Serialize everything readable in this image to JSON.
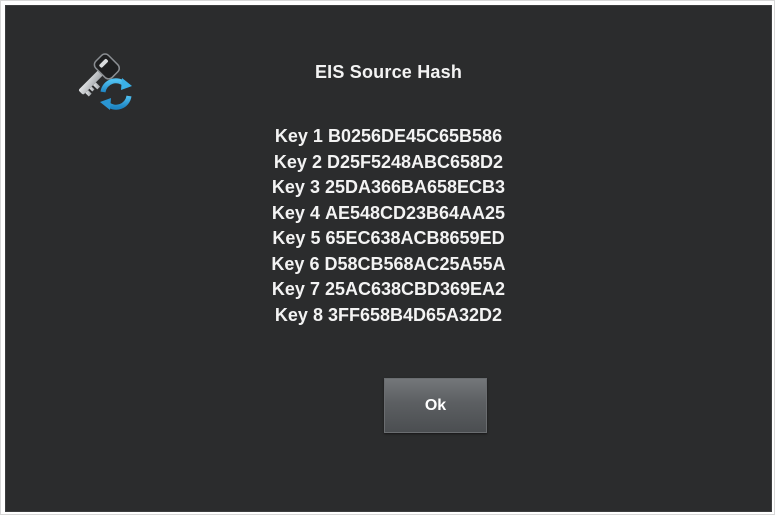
{
  "dialog": {
    "title": "EIS Source Hash",
    "icon": "key-sync-icon",
    "keys": [
      {
        "label": "Key 1",
        "value": "B0256DE45C65B586"
      },
      {
        "label": "Key 2",
        "value": "D25F5248ABC658D2"
      },
      {
        "label": "Key 3",
        "value": "25DA366BA658ECB3"
      },
      {
        "label": "Key 4",
        "value": "AE548CD23B64AA25"
      },
      {
        "label": "Key 5",
        "value": "65EC638ACB8659ED"
      },
      {
        "label": "Key 6",
        "value": "D58CB568AC25A55A"
      },
      {
        "label": "Key 7",
        "value": "25AC638CBD369EA2"
      },
      {
        "label": "Key 8",
        "value": "3FF658B4D65A32D2"
      }
    ],
    "ok_label": "Ok"
  },
  "colors": {
    "background": "#2b2c2d",
    "text": "#f3f3f3",
    "button": "#5c5f62",
    "icon_key": "#c8cbce",
    "icon_arrows": "#2f9fd8"
  }
}
